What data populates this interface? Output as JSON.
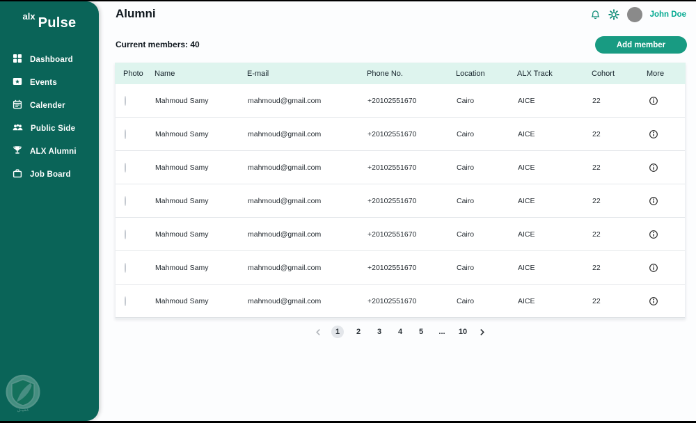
{
  "colors": {
    "sidebar_bg": "#0a6458",
    "accent": "#189b82",
    "table_header_bg": "#def4ee",
    "user_name_text": "#00a88f",
    "icon_teal": "#0a8a74"
  },
  "sidebar": {
    "logo": {
      "brand": "alx",
      "product": "Pulse"
    },
    "items": [
      {
        "label": "Dashboard",
        "icon": "dashboard-icon"
      },
      {
        "label": "Events",
        "icon": "events-icon"
      },
      {
        "label": "Calender",
        "icon": "calendar-icon"
      },
      {
        "label": "Public Side",
        "icon": "public-side-icon"
      },
      {
        "label": "ALX Alumni",
        "icon": "alumni-trophy-icon"
      },
      {
        "label": "Job Board",
        "icon": "job-board-icon"
      }
    ]
  },
  "topbar": {
    "icons": [
      "bell-icon",
      "gear-icon"
    ],
    "user_name": "John Doe"
  },
  "page": {
    "title": "Alumni",
    "members_label": "Current members: 40",
    "add_member_label": "Add member"
  },
  "table": {
    "columns": [
      "Photo",
      "Name",
      "E-mail",
      "Phone No.",
      "Location",
      "ALX Track",
      "Cohort",
      "More"
    ],
    "more_icon": "info-icon",
    "rows": [
      {
        "name": "Mahmoud Samy",
        "email": "mahmoud@gmail.com",
        "phone": "+20102551670",
        "location": "Cairo",
        "track": "AICE",
        "cohort": "22"
      },
      {
        "name": "Mahmoud Samy",
        "email": "mahmoud@gmail.com",
        "phone": "+20102551670",
        "location": "Cairo",
        "track": "AICE",
        "cohort": "22"
      },
      {
        "name": "Mahmoud Samy",
        "email": "mahmoud@gmail.com",
        "phone": "+20102551670",
        "location": "Cairo",
        "track": "AICE",
        "cohort": "22"
      },
      {
        "name": "Mahmoud Samy",
        "email": "mahmoud@gmail.com",
        "phone": "+20102551670",
        "location": "Cairo",
        "track": "AICE",
        "cohort": "22"
      },
      {
        "name": "Mahmoud Samy",
        "email": "mahmoud@gmail.com",
        "phone": "+20102551670",
        "location": "Cairo",
        "track": "AICE",
        "cohort": "22"
      },
      {
        "name": "Mahmoud Samy",
        "email": "mahmoud@gmail.com",
        "phone": "+20102551670",
        "location": "Cairo",
        "track": "AICE",
        "cohort": "22"
      },
      {
        "name": "Mahmoud Samy",
        "email": "mahmoud@gmail.com",
        "phone": "+20102551670",
        "location": "Cairo",
        "track": "AICE",
        "cohort": "22"
      }
    ]
  },
  "pagination": {
    "prev_icon": "chevron-left-icon",
    "next_icon": "chevron-right-icon",
    "pages": [
      "1",
      "2",
      "3",
      "4",
      "5",
      "...",
      "10"
    ],
    "active_page": "1"
  }
}
